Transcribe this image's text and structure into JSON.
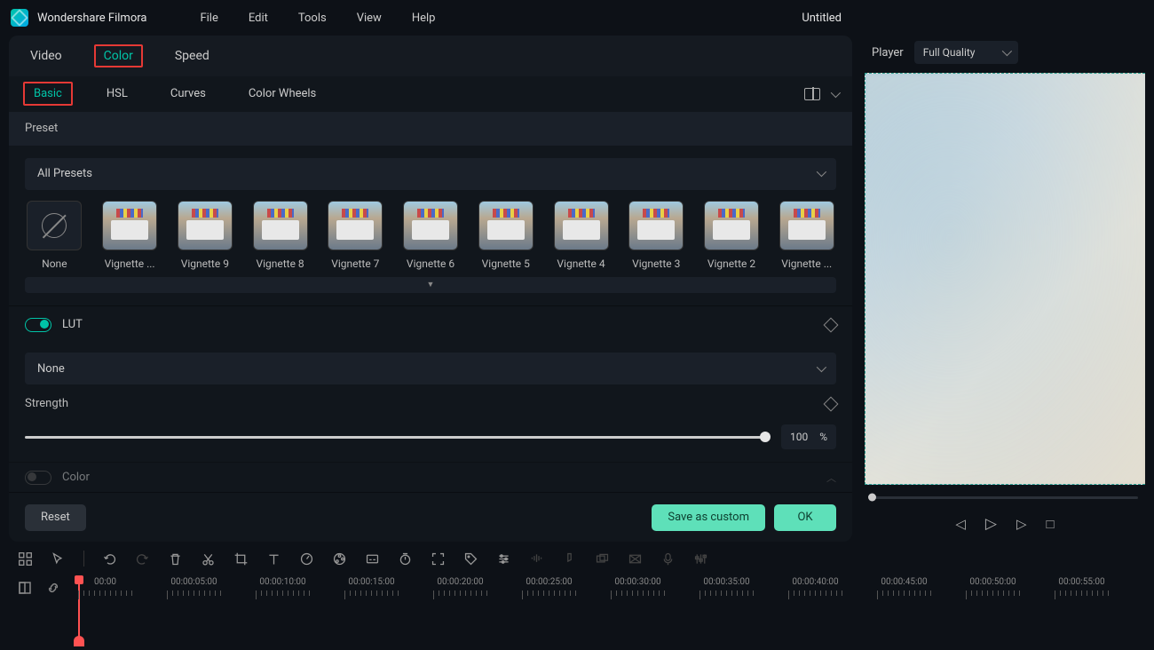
{
  "app": {
    "title": "Wondershare Filmora",
    "document": "Untitled"
  },
  "menu": [
    "File",
    "Edit",
    "Tools",
    "View",
    "Help"
  ],
  "topTabs": [
    "Video",
    "Color",
    "Speed"
  ],
  "topTabActive": 1,
  "subTabs": [
    "Basic",
    "HSL",
    "Curves",
    "Color Wheels"
  ],
  "subTabActive": 0,
  "preset": {
    "header": "Preset",
    "dropdown": "All Presets",
    "items": [
      "None",
      "Vignette ...",
      "Vignette 9",
      "Vignette 8",
      "Vignette 7",
      "Vignette 6",
      "Vignette 5",
      "Vignette 4",
      "Vignette 3",
      "Vignette 2",
      "Vignette ..."
    ]
  },
  "lut": {
    "label": "LUT",
    "dropdown": "None",
    "strengthLabel": "Strength",
    "strengthValue": "100",
    "strengthUnit": "%"
  },
  "color": {
    "label": "Color"
  },
  "buttons": {
    "reset": "Reset",
    "save": "Save as custom",
    "ok": "OK"
  },
  "player": {
    "label": "Player",
    "quality": "Full Quality"
  },
  "timeline": {
    "times": [
      "00:00",
      "00:00:05:00",
      "00:00:10:00",
      "00:00:15:00",
      "00:00:20:00",
      "00:00:25:00",
      "00:00:30:00",
      "00:00:35:00",
      "00:00:40:00",
      "00:00:45:00",
      "00:00:50:00",
      "00:00:55:00"
    ]
  }
}
